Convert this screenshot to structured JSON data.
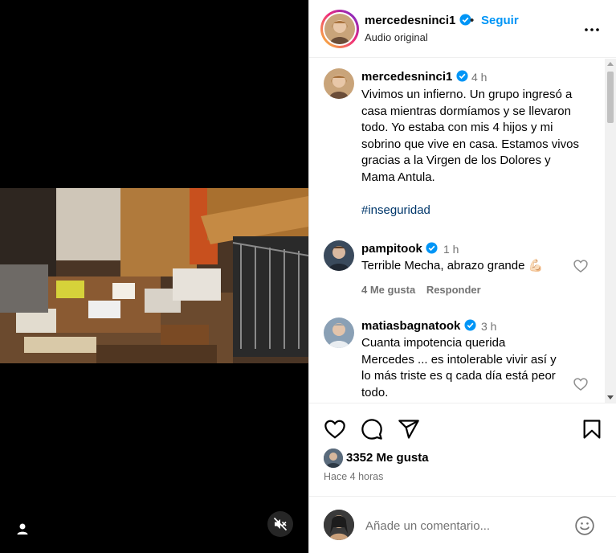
{
  "header": {
    "username": "mercedesninci1",
    "separator": "•",
    "follow_label": "Seguir",
    "subtitle": "Audio original"
  },
  "caption": {
    "username": "mercedesninci1",
    "time": "4 h",
    "lines": [
      "Vivimos un infierno. Un grupo ingresó a",
      "casa mientras dormíamos y se llevaron",
      "todo. Yo estaba con mis 4 hijos y mi",
      "sobrino que vive en casa. Estamos vivos",
      "gracias a la Virgen de los Dolores y",
      "Mama Antula."
    ],
    "hashtag": "#inseguridad"
  },
  "comments": [
    {
      "username": "pampitook",
      "time": "1 h",
      "lines": [
        "Terrible Mecha, abrazo grande 💪🏻"
      ],
      "likes": "4 Me gusta",
      "reply_label": "Responder"
    },
    {
      "username": "matiasbagnatook",
      "time": "3 h",
      "lines": [
        "Cuanta impotencia querida",
        "Mercedes ... es intolerable vivir así y",
        "lo más triste es q cada día está peor",
        "todo."
      ]
    }
  ],
  "footer": {
    "likes": "3352 Me gusta",
    "time_ago": "Hace 4 horas"
  },
  "composer": {
    "placeholder": "Añade un comentario..."
  },
  "icons": {
    "verified": "verified-badge-icon",
    "more": "more-options-icon",
    "like": "heart-icon",
    "comment": "comment-bubble-icon",
    "share": "paper-plane-icon",
    "save": "bookmark-icon",
    "emoji": "emoji-smile-icon",
    "mute": "volume-muted-icon",
    "user_tag": "user-tag-icon"
  },
  "colors": {
    "accent": "#0095f6",
    "verified": "#0095f6",
    "secondary_text": "#737373",
    "hashtag": "#00376b"
  }
}
